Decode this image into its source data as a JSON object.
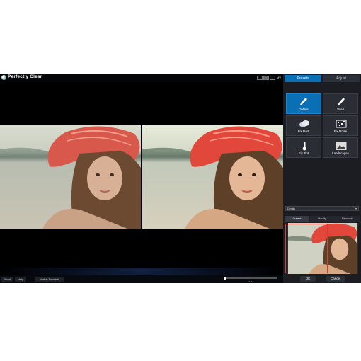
{
  "app": {
    "title": "Perfectly Clear"
  },
  "view_modes": {
    "label": "MV"
  },
  "side_panel": {
    "tabs": [
      {
        "label": "Presets"
      },
      {
        "label": "Adjust"
      }
    ],
    "presets": [
      {
        "label": "Details",
        "icon": "brush-icon",
        "active": true
      },
      {
        "label": "Vivid",
        "icon": "pen-icon",
        "active": false
      },
      {
        "label": "Fix Dark",
        "icon": "cloud-icon",
        "active": false
      },
      {
        "label": "Fix Noise",
        "icon": "noise-icon",
        "active": false
      },
      {
        "label": "Fix Tint",
        "icon": "thermometer-icon",
        "active": false
      },
      {
        "label": "Landscapes",
        "icon": "landscape-icon",
        "active": false
      }
    ],
    "category_select": {
      "value": "Details"
    },
    "sub_tabs": [
      {
        "label": "Create"
      },
      {
        "label": "Modify"
      },
      {
        "label": "Remove"
      }
    ],
    "ok_label": "OK",
    "cancel_label": "Cancel"
  },
  "bottom_bar": {
    "about_label": "About",
    "help_label": "Help",
    "tutorials_label": "Watch Tutorials",
    "zoom_label": "15 %"
  },
  "colors": {
    "accent": "#0b6fb5",
    "hat_red": "#e2473c",
    "panel_bg": "#1b1d22",
    "thumb_frame": "#e03a2f"
  }
}
